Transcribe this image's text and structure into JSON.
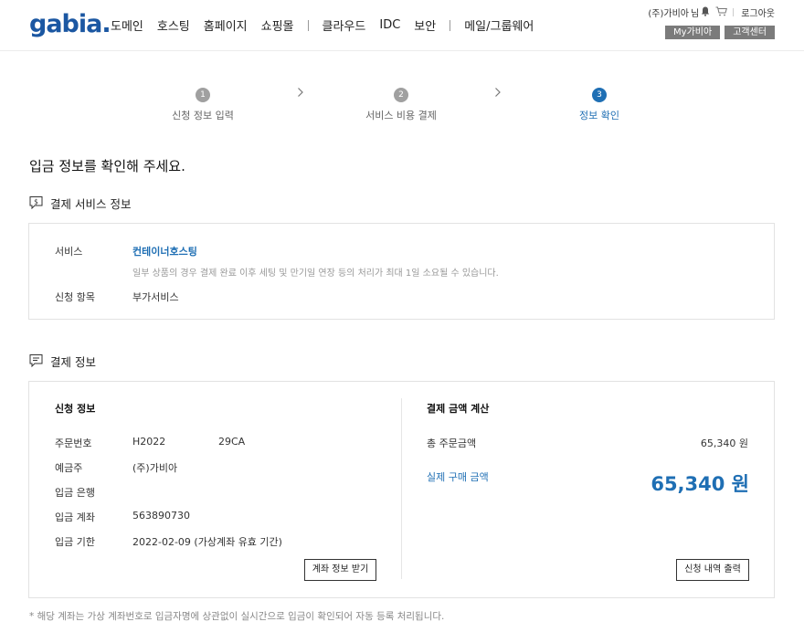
{
  "header": {
    "logo_text": "gabia",
    "logo_dot": ".",
    "nav": [
      "도메인",
      "호스팅",
      "홈페이지",
      "쇼핑몰",
      "클라우드",
      "IDC",
      "보안",
      "메일/그룹웨어"
    ],
    "user_text": "(주)가비아",
    "user_suffix": "님",
    "logout": "로그아웃",
    "mygabia": "My가비아",
    "support": "고객센터"
  },
  "steps": [
    {
      "num": "1",
      "label": "신청 정보 입력"
    },
    {
      "num": "2",
      "label": "서비스 비용 결제"
    },
    {
      "num": "3",
      "label": "정보 확인"
    }
  ],
  "heading": "입금 정보를 확인해 주세요.",
  "service_section": {
    "title": "결제 서비스 정보",
    "service_label": "서비스",
    "service_value": "컨테이너호스팅",
    "notice": "일부 상품의 경우 결제 완료 이후 세팅 및 만기일 연장 등의 처리가 최대 1일 소요될 수 있습니다.",
    "item_label": "신청 항목",
    "item_value": "부가서비스"
  },
  "payment_section": {
    "title": "결제 정보",
    "left_title": "신청 정보",
    "rows": [
      {
        "label": "주문번호",
        "value": "H2022",
        "value2": "29CA"
      },
      {
        "label": "예금주",
        "value": "(주)가비아"
      },
      {
        "label": "입금 은행",
        "value": ""
      },
      {
        "label": "입금 계좌",
        "value": "563890730"
      },
      {
        "label": "입금 기한",
        "value": "2022-02-09 (가상계좌 유효 기간)"
      }
    ],
    "account_button": "계좌 정보 받기",
    "right_title": "결제 금액 계산",
    "total_label": "총 주문금액",
    "total_value": "65,340 원",
    "actual_label": "실제 구매 금액",
    "actual_value": "65,340 원",
    "print_button": "신청 내역 출력"
  },
  "footnote": "* 해당 계좌는 가상 계좌번호로 입금자명에 상관없이 실시간으로 입금이 확인되어 자동 등록 처리됩니다.",
  "colors": {
    "brand": "#1b57a2",
    "accent": "#1f6fb4",
    "step_inactive": "#a0a0a0"
  }
}
